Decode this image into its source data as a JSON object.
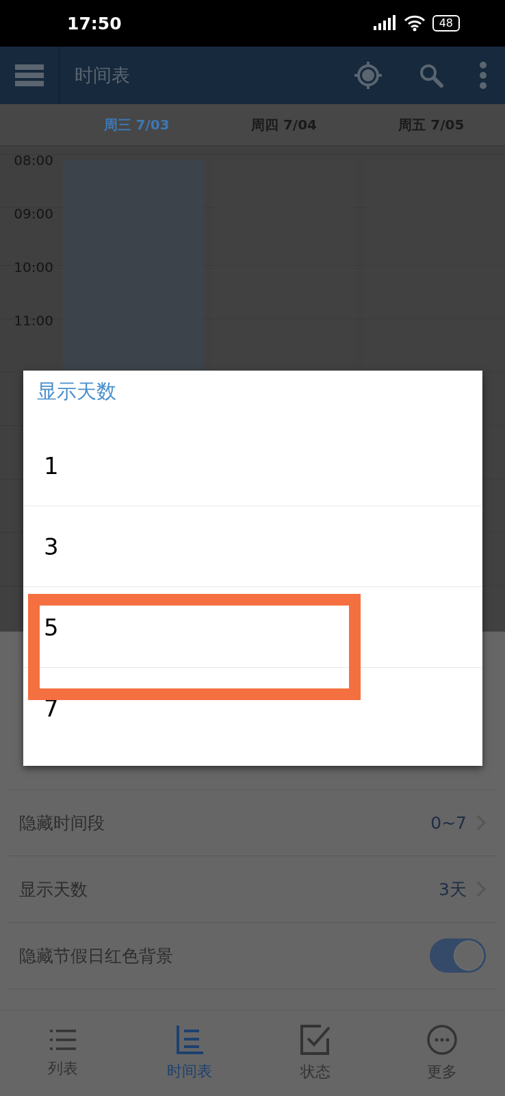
{
  "status_bar": {
    "time": "17:50",
    "battery": "48"
  },
  "app_bar": {
    "title": "时间表"
  },
  "days": [
    {
      "label": "周三 7/03",
      "selected": true
    },
    {
      "label": "周四 7/04",
      "selected": false
    },
    {
      "label": "周五 7/05",
      "selected": false
    }
  ],
  "hours": [
    "08:00",
    "09:00",
    "10:00",
    "11:00"
  ],
  "settings": [
    {
      "kind": "value",
      "label": "隐藏时间段",
      "value": "0~7"
    },
    {
      "kind": "value",
      "label": "显示天数",
      "value": "3天"
    },
    {
      "kind": "toggle",
      "label": "隐藏节假日红色背景",
      "on": true
    }
  ],
  "bottom_nav": [
    {
      "label": "列表",
      "selected": false
    },
    {
      "label": "时间表",
      "selected": true
    },
    {
      "label": "状态",
      "selected": false
    },
    {
      "label": "更多",
      "selected": false
    }
  ],
  "dialog": {
    "title": "显示天数",
    "options": [
      {
        "label": "1",
        "framed": false
      },
      {
        "label": "3",
        "framed": false
      },
      {
        "label": "5",
        "framed": true
      },
      {
        "label": "7",
        "framed": false
      }
    ]
  }
}
